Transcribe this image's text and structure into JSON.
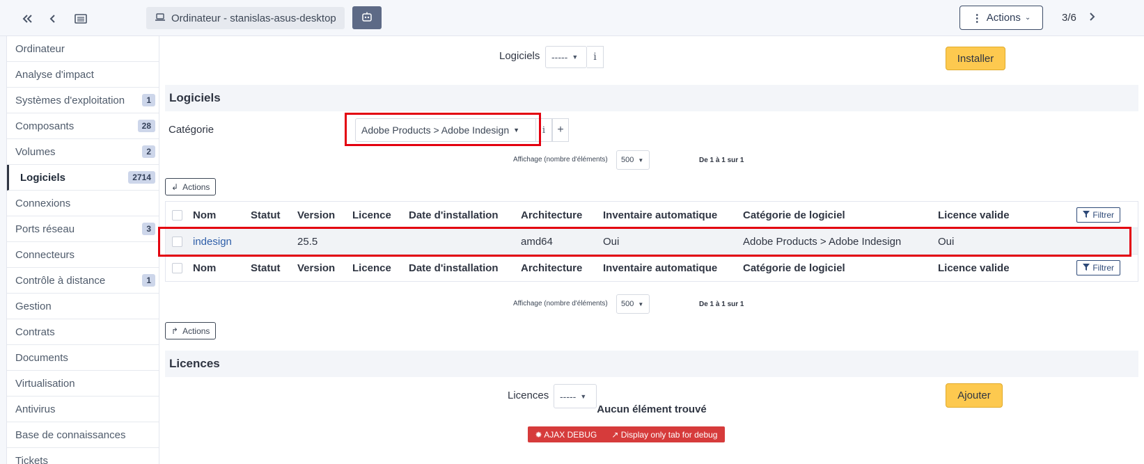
{
  "header": {
    "title": "Ordinateur - stanislas-asus-desktop",
    "actions_label": "Actions",
    "pager": "3/6"
  },
  "sidebar": {
    "items": [
      {
        "label": "Ordinateur",
        "count": ""
      },
      {
        "label": "Analyse d'impact",
        "count": ""
      },
      {
        "label": "Systèmes d'exploitation",
        "count": "1"
      },
      {
        "label": "Composants",
        "count": "28"
      },
      {
        "label": "Volumes",
        "count": "2"
      },
      {
        "label": "Logiciels",
        "count": "2714"
      },
      {
        "label": "Connexions",
        "count": ""
      },
      {
        "label": "Ports réseau",
        "count": "3"
      },
      {
        "label": "Connecteurs",
        "count": ""
      },
      {
        "label": "Contrôle à distance",
        "count": "1"
      },
      {
        "label": "Gestion",
        "count": ""
      },
      {
        "label": "Contrats",
        "count": ""
      },
      {
        "label": "Documents",
        "count": ""
      },
      {
        "label": "Virtualisation",
        "count": ""
      },
      {
        "label": "Antivirus",
        "count": ""
      },
      {
        "label": "Base de connaissances",
        "count": ""
      },
      {
        "label": "Tickets",
        "count": ""
      }
    ]
  },
  "install": {
    "label": "Logiciels",
    "select_value": "-----",
    "info_label": "i",
    "button_label": "Installer"
  },
  "software_section": {
    "title": "Logiciels",
    "category_label": "Catégorie",
    "category_value": "Adobe Products > Adobe Indesign",
    "info_label": "i",
    "add_label": "+"
  },
  "pagination": {
    "display_label": "Affichage (nombre d'éléments)",
    "per_page": "500",
    "count_text": "De 1 à 1 sur 1",
    "actions_label": "Actions"
  },
  "table": {
    "columns": [
      "Nom",
      "Statut",
      "Version",
      "Licence",
      "Date d'installation",
      "Architecture",
      "Inventaire automatique",
      "Catégorie de logiciel",
      "Licence valide"
    ],
    "filter_label": "Filtrer",
    "rows": [
      [
        "indesign",
        "",
        "25.5",
        "",
        "",
        "amd64",
        "Oui",
        "Adobe Products > Adobe Indesign",
        "Oui"
      ]
    ]
  },
  "licences_section": {
    "title": "Licences",
    "label": "Licences",
    "select_value": "-----",
    "button_label": "Ajouter",
    "empty_message": "Aucun élément trouvé"
  },
  "debug": {
    "ajax_label": "AJAX DEBUG",
    "tab_label": "Display only tab for debug"
  },
  "colors": {
    "accent_yellow": "#fdc94f",
    "highlight_red": "#e3000f",
    "debug_red": "#d63b3b",
    "link_blue": "#2e5ea8"
  }
}
